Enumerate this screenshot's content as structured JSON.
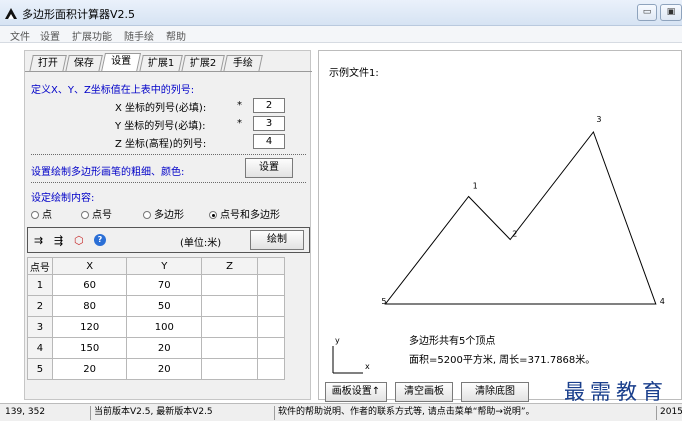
{
  "window": {
    "title": "多边形面积计算器V2.5"
  },
  "menu": [
    "文件",
    "设置",
    "扩展功能",
    "随手绘",
    "帮助"
  ],
  "tabs": [
    "打开",
    "保存",
    "设置",
    "扩展1",
    "扩展2",
    "手绘"
  ],
  "settings": {
    "define_label": "定义X、Y、Z坐标值在上表中的列号:",
    "x_label": "X 坐标的列号(必填):",
    "y_label": "Y 坐标的列号(必填):",
    "z_label": "Z 坐标(高程)的列号:",
    "required_mark": "*",
    "x_col": "2",
    "y_col": "3",
    "z_col": "4",
    "style_label": "设置绘制多边形画笔的粗细、颜色:",
    "style_button": "设置",
    "content_label": "设定绘制内容:",
    "options": [
      "点",
      "点号",
      "多边形",
      "点号和多边形"
    ],
    "selected_option": "点号和多边形"
  },
  "toolbar": {
    "unit_label": "(单位:米)",
    "draw_button": "绘制"
  },
  "table": {
    "headers": [
      "点号",
      "X",
      "Y",
      "Z"
    ],
    "rows": [
      [
        "1",
        "60",
        "70",
        ""
      ],
      [
        "2",
        "80",
        "50",
        ""
      ],
      [
        "3",
        "120",
        "100",
        ""
      ],
      [
        "4",
        "150",
        "20",
        ""
      ],
      [
        "5",
        "20",
        "20",
        ""
      ]
    ]
  },
  "canvas": {
    "file_label": "示例文件1:",
    "summary_line1": "多边形共有5个顶点",
    "summary_line2": "面积=5200平方米, 周长=371.7868米。",
    "axis_x": "x",
    "axis_y": "y"
  },
  "bottom_buttons": [
    "画板设置↑",
    "清空画板",
    "清除底图"
  ],
  "watermark": "最需教育",
  "status": {
    "coords": "139, 352",
    "version": "当前版本V2.5, 最新版本V2.5",
    "message": "软件的帮助说明、作者的联系方式等, 请点击菜单“帮助→说明”。",
    "year": "2015"
  }
}
